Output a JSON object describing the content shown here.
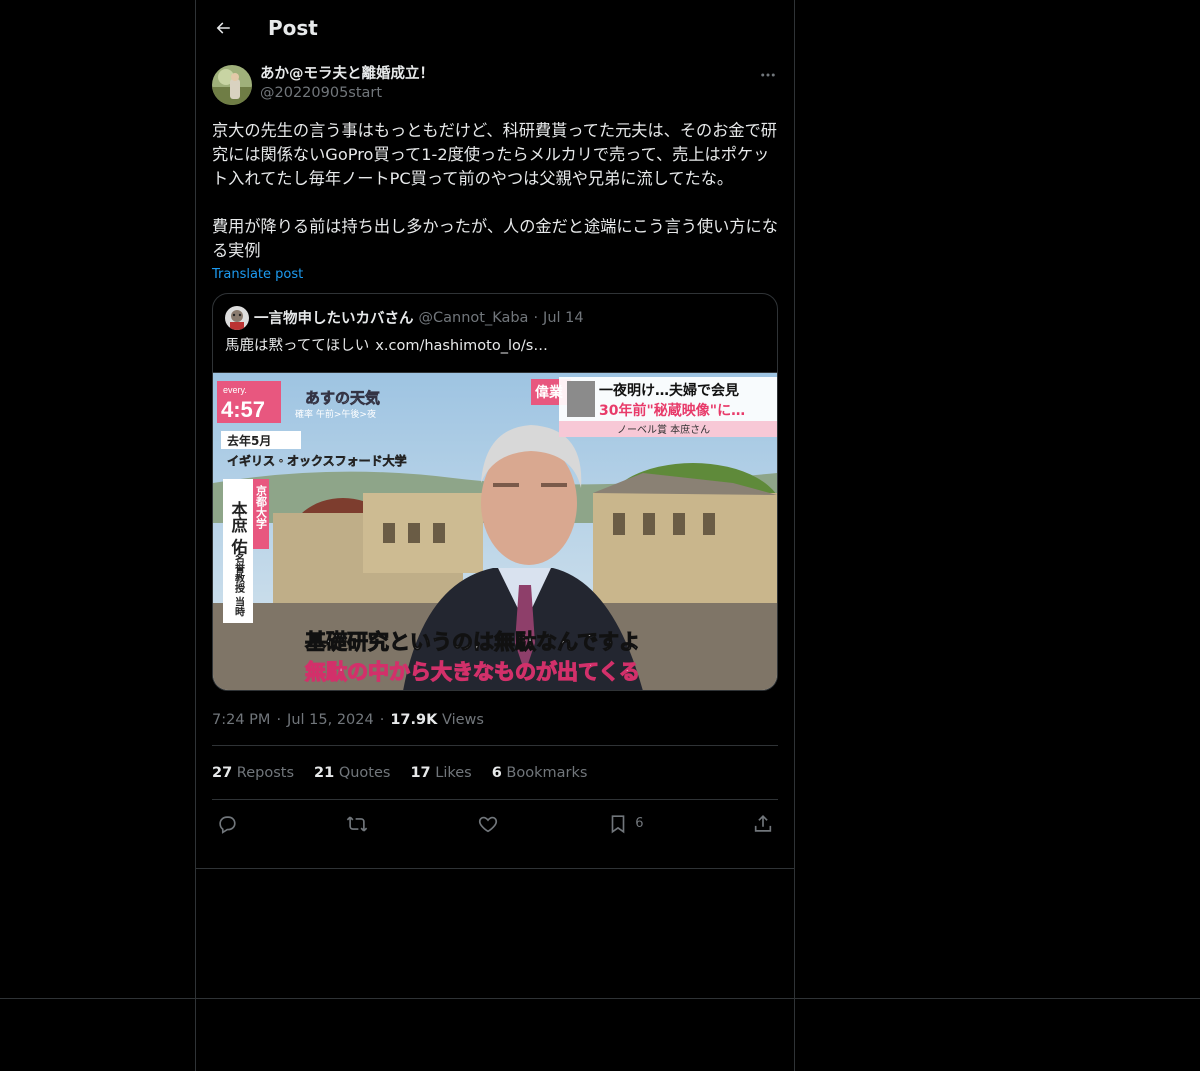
{
  "header": {
    "title": "Post"
  },
  "post": {
    "author_name": "あか@モラ夫と離婚成立！",
    "author_handle": "@20220905start",
    "text": "京大の先生の言う事はもっともだけど、科研費貰ってた元夫は、そのお金で研究には関係ないGoPro買って1-2度使ったらメルカリで売って、売上はポケット入れてたし毎年ノートPC買って前のやつは父親や兄弟に流してたな。\n\n費用が降りる前は持ち出し多かったが、人の金だと途端にこう言う使い方になる実例",
    "translate_label": "Translate post"
  },
  "quote": {
    "name": "一言物申したいカバさん",
    "handle": "@Cannot_Kaba",
    "date": "Jul 14",
    "text": "馬鹿は黙っててほしい",
    "link": "x.com/hashimoto_lo/s…",
    "media": {
      "logo": "every.",
      "clock": "4:57",
      "weather_title": "あすの天気",
      "weather_sub": "確率 午前>午後>夜",
      "tag": "偉業",
      "headline1": "一夜明け…夫婦で会見",
      "headline2": "30年前\"秘蔵映像\"に…",
      "headline_sub": "ノーベル賞 本庶さん",
      "place1": "去年5月",
      "place2": "イギリス・オックスフォード大学",
      "name_vertical": "本庶 佑",
      "affil_vertical": "京都大学",
      "title_vertical": "名誉教授 当時",
      "caption1": "基礎研究というのは無駄なんですよ",
      "caption2": "無駄の中から大きなものが出てくる"
    }
  },
  "meta": {
    "time": "7:24 PM",
    "date": "Jul 15, 2024",
    "views_count": "17.9K",
    "views_label": "Views"
  },
  "stats": {
    "reposts_count": "27",
    "reposts_label": "Reposts",
    "quotes_count": "21",
    "quotes_label": "Quotes",
    "likes_count": "17",
    "likes_label": "Likes",
    "bookmarks_count": "6",
    "bookmarks_label": "Bookmarks"
  },
  "actions": {
    "bookmark_count": "6"
  },
  "colors": {
    "background": "#000000",
    "text": "#e7e9ea",
    "muted": "#71767b",
    "link": "#1d9bf0",
    "border": "#2f3336"
  },
  "icons": [
    "back-arrow-icon",
    "more-icon",
    "reply-icon",
    "repost-icon",
    "like-icon",
    "bookmark-icon",
    "share-icon"
  ]
}
